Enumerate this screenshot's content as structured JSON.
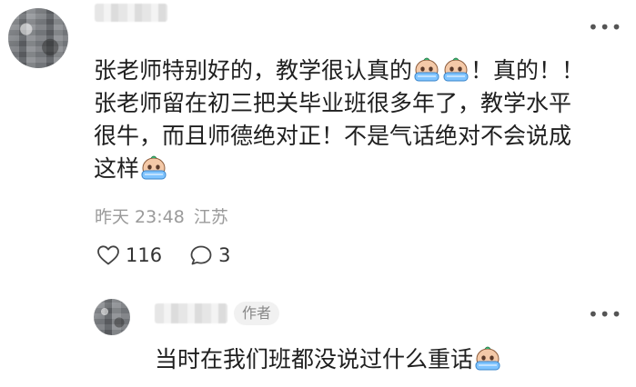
{
  "comment": {
    "lines": [
      "张老师特别好的，教学很认真的",
      "！真的！！",
      "张老师留在初三把关毕业班很多年了，教学水平",
      "很牛，而且师德绝对正！不是气话绝对不会说成",
      "这样"
    ],
    "timestamp": "昨天 23:48",
    "location": "江苏",
    "likes": "116",
    "replies": "3"
  },
  "reply": {
    "author_badge": "作者",
    "text": "当时在我们班都没说过什么重话"
  },
  "icons": {
    "more": "more-options-icon",
    "like": "heart-outline-icon",
    "comment": "comment-bubble-icon",
    "emoji": "crying-face-emoji"
  },
  "colors": {
    "text": "#1f1f1f",
    "meta": "#9a9a9a",
    "badge_bg": "#f1f1f1"
  }
}
